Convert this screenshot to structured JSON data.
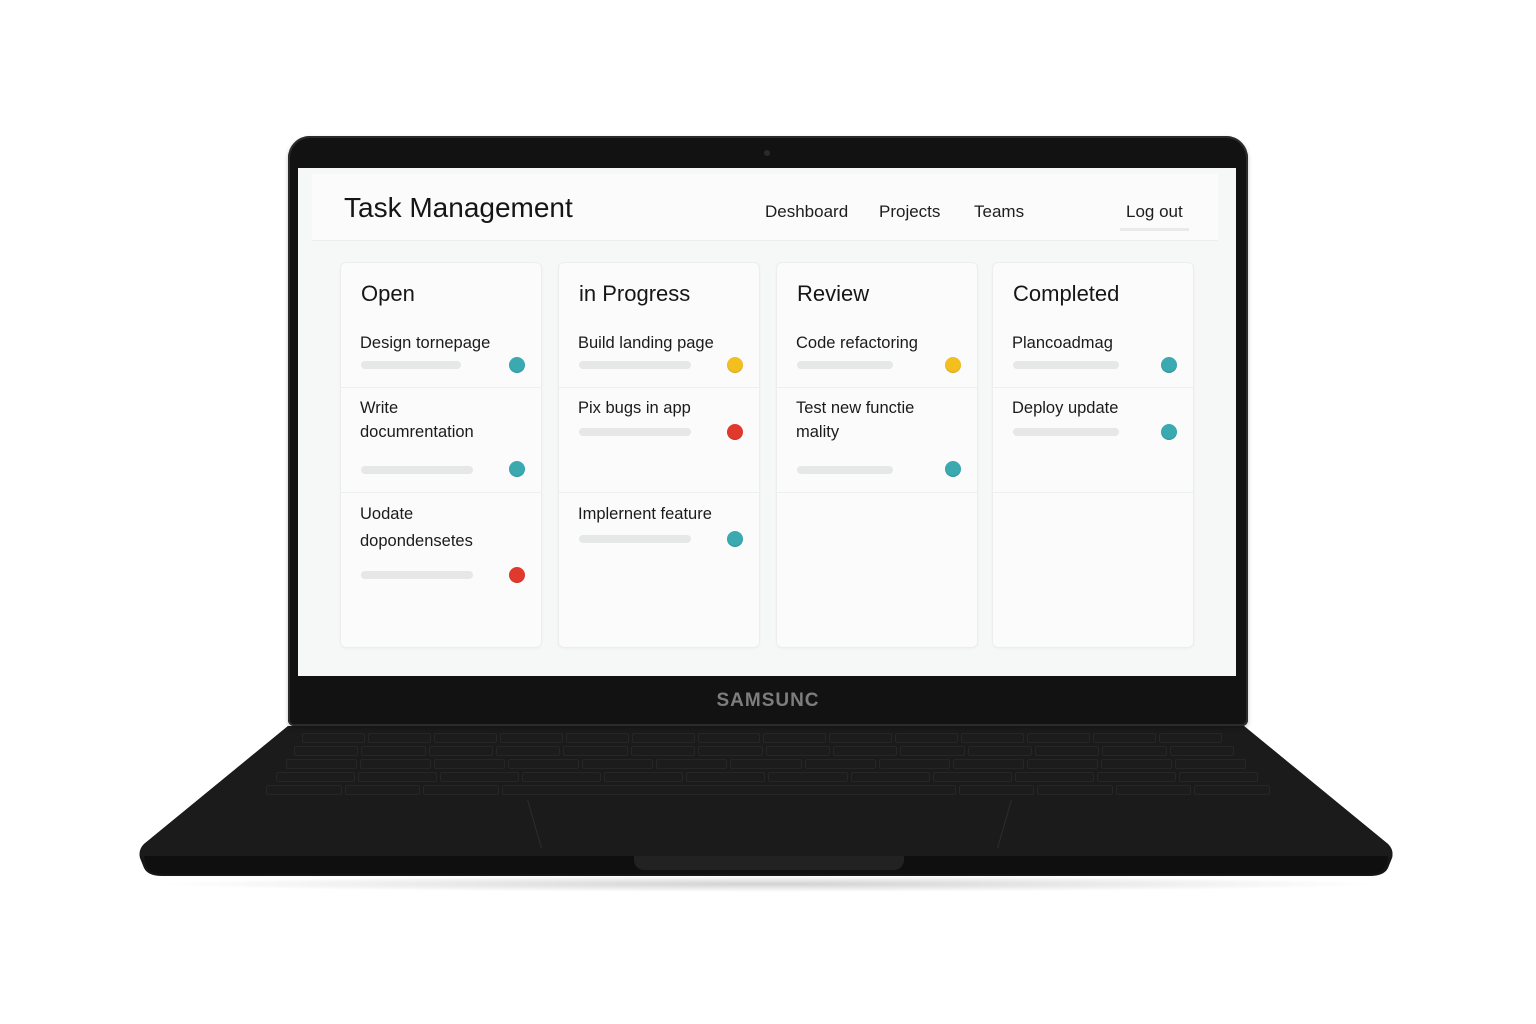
{
  "device": {
    "brand": "SAMSUNC"
  },
  "header": {
    "title": "Task Management",
    "nav": {
      "dashboard": "Deshboard",
      "projects": "Projects",
      "teams": "Teams",
      "logout": "Log out"
    }
  },
  "colors": {
    "teal": "#3aa9b0",
    "yellow": "#f2bf1e",
    "red": "#e2392e"
  },
  "columns": [
    {
      "title": "Open",
      "tasks": [
        {
          "title": "Design tornepage",
          "status": "teal"
        },
        {
          "title": "Write documrentation",
          "status": "teal"
        },
        {
          "title": "Uodate dopondensetes",
          "status": "red"
        }
      ]
    },
    {
      "title": "in Progress",
      "tasks": [
        {
          "title": "Build landing page",
          "status": "yellow"
        },
        {
          "title": "Pix bugs in app",
          "status": "red"
        },
        {
          "title": "Implernent feature",
          "status": "teal"
        }
      ]
    },
    {
      "title": "Review",
      "tasks": [
        {
          "title": "Code refactoring",
          "status": "yellow"
        },
        {
          "title": "Test new functie mality",
          "status": "teal"
        }
      ]
    },
    {
      "title": "Completed",
      "tasks": [
        {
          "title": "Plancoadmag",
          "status": "teal"
        },
        {
          "title": "Deploy update",
          "status": "teal"
        }
      ]
    }
  ]
}
